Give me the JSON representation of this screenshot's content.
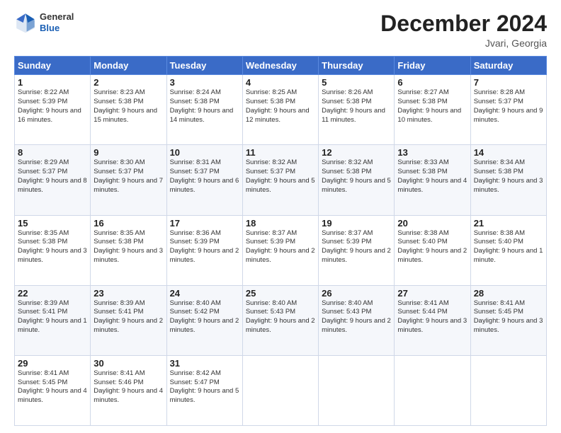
{
  "header": {
    "logo_general": "General",
    "logo_blue": "Blue",
    "month_title": "December 2024",
    "location": "Jvari, Georgia"
  },
  "days_of_week": [
    "Sunday",
    "Monday",
    "Tuesday",
    "Wednesday",
    "Thursday",
    "Friday",
    "Saturday"
  ],
  "weeks": [
    [
      {
        "day": "1",
        "sunrise": "8:22 AM",
        "sunset": "5:39 PM",
        "daylight": "9 hours and 16 minutes."
      },
      {
        "day": "2",
        "sunrise": "8:23 AM",
        "sunset": "5:38 PM",
        "daylight": "9 hours and 15 minutes."
      },
      {
        "day": "3",
        "sunrise": "8:24 AM",
        "sunset": "5:38 PM",
        "daylight": "9 hours and 14 minutes."
      },
      {
        "day": "4",
        "sunrise": "8:25 AM",
        "sunset": "5:38 PM",
        "daylight": "9 hours and 12 minutes."
      },
      {
        "day": "5",
        "sunrise": "8:26 AM",
        "sunset": "5:38 PM",
        "daylight": "9 hours and 11 minutes."
      },
      {
        "day": "6",
        "sunrise": "8:27 AM",
        "sunset": "5:38 PM",
        "daylight": "9 hours and 10 minutes."
      },
      {
        "day": "7",
        "sunrise": "8:28 AM",
        "sunset": "5:37 PM",
        "daylight": "9 hours and 9 minutes."
      }
    ],
    [
      {
        "day": "8",
        "sunrise": "8:29 AM",
        "sunset": "5:37 PM",
        "daylight": "9 hours and 8 minutes."
      },
      {
        "day": "9",
        "sunrise": "8:30 AM",
        "sunset": "5:37 PM",
        "daylight": "9 hours and 7 minutes."
      },
      {
        "day": "10",
        "sunrise": "8:31 AM",
        "sunset": "5:37 PM",
        "daylight": "9 hours and 6 minutes."
      },
      {
        "day": "11",
        "sunrise": "8:32 AM",
        "sunset": "5:37 PM",
        "daylight": "9 hours and 5 minutes."
      },
      {
        "day": "12",
        "sunrise": "8:32 AM",
        "sunset": "5:38 PM",
        "daylight": "9 hours and 5 minutes."
      },
      {
        "day": "13",
        "sunrise": "8:33 AM",
        "sunset": "5:38 PM",
        "daylight": "9 hours and 4 minutes."
      },
      {
        "day": "14",
        "sunrise": "8:34 AM",
        "sunset": "5:38 PM",
        "daylight": "9 hours and 3 minutes."
      }
    ],
    [
      {
        "day": "15",
        "sunrise": "8:35 AM",
        "sunset": "5:38 PM",
        "daylight": "9 hours and 3 minutes."
      },
      {
        "day": "16",
        "sunrise": "8:35 AM",
        "sunset": "5:38 PM",
        "daylight": "9 hours and 3 minutes."
      },
      {
        "day": "17",
        "sunrise": "8:36 AM",
        "sunset": "5:39 PM",
        "daylight": "9 hours and 2 minutes."
      },
      {
        "day": "18",
        "sunrise": "8:37 AM",
        "sunset": "5:39 PM",
        "daylight": "9 hours and 2 minutes."
      },
      {
        "day": "19",
        "sunrise": "8:37 AM",
        "sunset": "5:39 PM",
        "daylight": "9 hours and 2 minutes."
      },
      {
        "day": "20",
        "sunrise": "8:38 AM",
        "sunset": "5:40 PM",
        "daylight": "9 hours and 2 minutes."
      },
      {
        "day": "21",
        "sunrise": "8:38 AM",
        "sunset": "5:40 PM",
        "daylight": "9 hours and 1 minute."
      }
    ],
    [
      {
        "day": "22",
        "sunrise": "8:39 AM",
        "sunset": "5:41 PM",
        "daylight": "9 hours and 1 minute."
      },
      {
        "day": "23",
        "sunrise": "8:39 AM",
        "sunset": "5:41 PM",
        "daylight": "9 hours and 2 minutes."
      },
      {
        "day": "24",
        "sunrise": "8:40 AM",
        "sunset": "5:42 PM",
        "daylight": "9 hours and 2 minutes."
      },
      {
        "day": "25",
        "sunrise": "8:40 AM",
        "sunset": "5:43 PM",
        "daylight": "9 hours and 2 minutes."
      },
      {
        "day": "26",
        "sunrise": "8:40 AM",
        "sunset": "5:43 PM",
        "daylight": "9 hours and 2 minutes."
      },
      {
        "day": "27",
        "sunrise": "8:41 AM",
        "sunset": "5:44 PM",
        "daylight": "9 hours and 3 minutes."
      },
      {
        "day": "28",
        "sunrise": "8:41 AM",
        "sunset": "5:45 PM",
        "daylight": "9 hours and 3 minutes."
      }
    ],
    [
      {
        "day": "29",
        "sunrise": "8:41 AM",
        "sunset": "5:45 PM",
        "daylight": "9 hours and 4 minutes."
      },
      {
        "day": "30",
        "sunrise": "8:41 AM",
        "sunset": "5:46 PM",
        "daylight": "9 hours and 4 minutes."
      },
      {
        "day": "31",
        "sunrise": "8:42 AM",
        "sunset": "5:47 PM",
        "daylight": "9 hours and 5 minutes."
      },
      null,
      null,
      null,
      null
    ]
  ]
}
